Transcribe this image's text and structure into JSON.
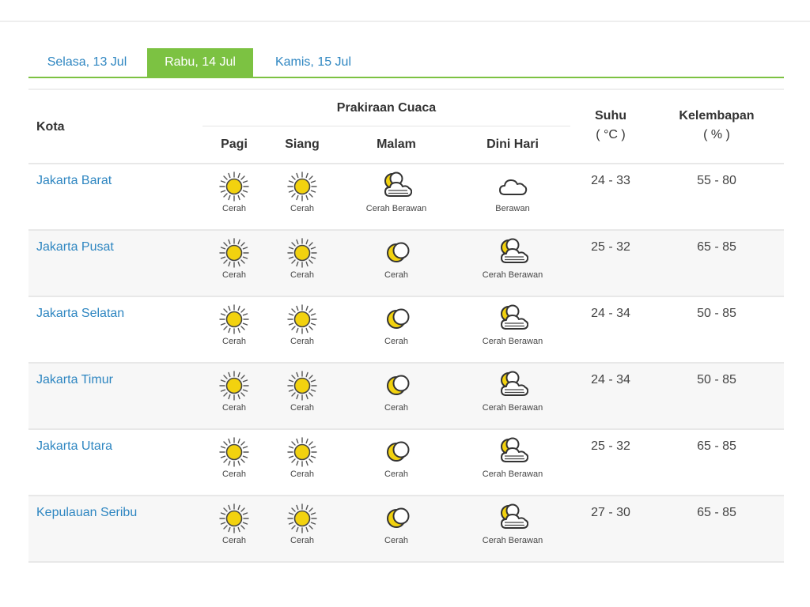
{
  "tabs": [
    {
      "label": "Selasa, 13 Jul",
      "active": false
    },
    {
      "label": "Rabu, 14 Jul",
      "active": true
    },
    {
      "label": "Kamis, 15 Jul",
      "active": false
    }
  ],
  "header": {
    "kota": "Kota",
    "prakiraan": "Prakiraan Cuaca",
    "periods": [
      "Pagi",
      "Siang",
      "Malam",
      "Dini Hari"
    ],
    "suhu": "Suhu",
    "suhu_unit": "( °C )",
    "kelembapan": "Kelembapan",
    "kelembapan_unit": "( % )"
  },
  "rows": [
    {
      "city": "Jakarta Barat",
      "forecast": [
        {
          "label": "Cerah",
          "icon": "sun-icon"
        },
        {
          "label": "Cerah",
          "icon": "sun-icon"
        },
        {
          "label": "Cerah Berawan",
          "icon": "moon-cloud-icon"
        },
        {
          "label": "Berawan",
          "icon": "cloud-icon"
        }
      ],
      "suhu": "24 - 33",
      "kelembapan": "55 - 80"
    },
    {
      "city": "Jakarta Pusat",
      "forecast": [
        {
          "label": "Cerah",
          "icon": "sun-icon"
        },
        {
          "label": "Cerah",
          "icon": "sun-icon"
        },
        {
          "label": "Cerah",
          "icon": "moon-icon"
        },
        {
          "label": "Cerah Berawan",
          "icon": "moon-cloud-icon"
        }
      ],
      "suhu": "25 - 32",
      "kelembapan": "65 - 85"
    },
    {
      "city": "Jakarta Selatan",
      "forecast": [
        {
          "label": "Cerah",
          "icon": "sun-icon"
        },
        {
          "label": "Cerah",
          "icon": "sun-icon"
        },
        {
          "label": "Cerah",
          "icon": "moon-icon"
        },
        {
          "label": "Cerah Berawan",
          "icon": "moon-cloud-icon"
        }
      ],
      "suhu": "24 - 34",
      "kelembapan": "50 - 85"
    },
    {
      "city": "Jakarta Timur",
      "forecast": [
        {
          "label": "Cerah",
          "icon": "sun-icon"
        },
        {
          "label": "Cerah",
          "icon": "sun-icon"
        },
        {
          "label": "Cerah",
          "icon": "moon-icon"
        },
        {
          "label": "Cerah Berawan",
          "icon": "moon-cloud-icon"
        }
      ],
      "suhu": "24 - 34",
      "kelembapan": "50 - 85"
    },
    {
      "city": "Jakarta Utara",
      "forecast": [
        {
          "label": "Cerah",
          "icon": "sun-icon"
        },
        {
          "label": "Cerah",
          "icon": "sun-icon"
        },
        {
          "label": "Cerah",
          "icon": "moon-icon"
        },
        {
          "label": "Cerah Berawan",
          "icon": "moon-cloud-icon"
        }
      ],
      "suhu": "25 - 32",
      "kelembapan": "65 - 85"
    },
    {
      "city": "Kepulauan Seribu",
      "forecast": [
        {
          "label": "Cerah",
          "icon": "sun-icon"
        },
        {
          "label": "Cerah",
          "icon": "sun-icon"
        },
        {
          "label": "Cerah",
          "icon": "moon-icon"
        },
        {
          "label": "Cerah Berawan",
          "icon": "moon-cloud-icon"
        }
      ],
      "suhu": "27 - 30",
      "kelembapan": "65 - 85"
    }
  ],
  "colors": {
    "accent": "#7cc242",
    "link": "#2e86c1",
    "sun": "#f2d20f"
  }
}
